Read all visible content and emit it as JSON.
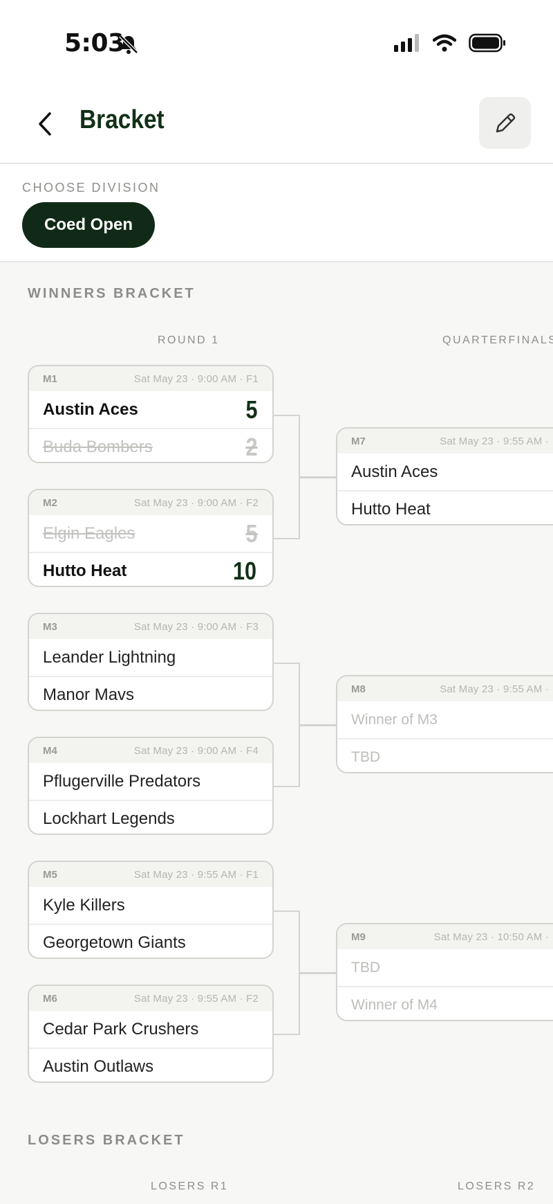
{
  "status": {
    "time": "5:03"
  },
  "header": {
    "title": "Bracket"
  },
  "division": {
    "label": "CHOOSE DIVISION",
    "selected": "Coed Open"
  },
  "winners": {
    "label": "WINNERS BRACKET",
    "round1_label": "ROUND 1",
    "qf_label": "QUARTERFINALS",
    "round1": [
      {
        "id": "M1",
        "meta": "Sat May 23 · 9:00 AM · F1",
        "teams": [
          {
            "name": "Austin Aces",
            "score": "5",
            "state": "win"
          },
          {
            "name": "Buda Bombers",
            "score": "2",
            "state": "lose"
          }
        ]
      },
      {
        "id": "M2",
        "meta": "Sat May 23 · 9:00 AM · F2",
        "teams": [
          {
            "name": "Elgin Eagles",
            "score": "5",
            "state": "lose"
          },
          {
            "name": "Hutto Heat",
            "score": "10",
            "state": "win"
          }
        ]
      },
      {
        "id": "M3",
        "meta": "Sat May 23 · 9:00 AM · F3",
        "teams": [
          {
            "name": "Leander Lightning",
            "score": "",
            "state": "normal"
          },
          {
            "name": "Manor Mavs",
            "score": "",
            "state": "normal"
          }
        ]
      },
      {
        "id": "M4",
        "meta": "Sat May 23 · 9:00 AM · F4",
        "teams": [
          {
            "name": "Pflugerville Predators",
            "score": "",
            "state": "normal"
          },
          {
            "name": "Lockhart Legends",
            "score": "",
            "state": "normal"
          }
        ]
      },
      {
        "id": "M5",
        "meta": "Sat May 23 · 9:55 AM · F1",
        "teams": [
          {
            "name": "Kyle Killers",
            "score": "",
            "state": "normal"
          },
          {
            "name": "Georgetown Giants",
            "score": "",
            "state": "normal"
          }
        ]
      },
      {
        "id": "M6",
        "meta": "Sat May 23 · 9:55 AM · F2",
        "teams": [
          {
            "name": "Cedar Park Crushers",
            "score": "",
            "state": "normal"
          },
          {
            "name": "Austin Outlaws",
            "score": "",
            "state": "normal"
          }
        ]
      }
    ],
    "quarterfinals": [
      {
        "id": "M7",
        "meta": "Sat May 23 · 9:55 AM ·",
        "teams": [
          {
            "name": "Austin Aces",
            "state": "normal"
          },
          {
            "name": "Hutto Heat",
            "state": "normal"
          }
        ]
      },
      {
        "id": "M8",
        "meta": "Sat May 23 · 9:55 AM ·",
        "teams": [
          {
            "name": "Winner of M3",
            "state": "pending"
          },
          {
            "name": "TBD",
            "state": "pending"
          }
        ]
      },
      {
        "id": "M9",
        "meta": "Sat May 23 · 10:50 AM ·",
        "teams": [
          {
            "name": "TBD",
            "state": "pending"
          },
          {
            "name": "Winner of M4",
            "state": "pending"
          }
        ]
      }
    ]
  },
  "losers": {
    "label": "LOSERS BRACKET",
    "r1_label": "LOSERS R1",
    "r2_label": "LOSERS R2"
  }
}
